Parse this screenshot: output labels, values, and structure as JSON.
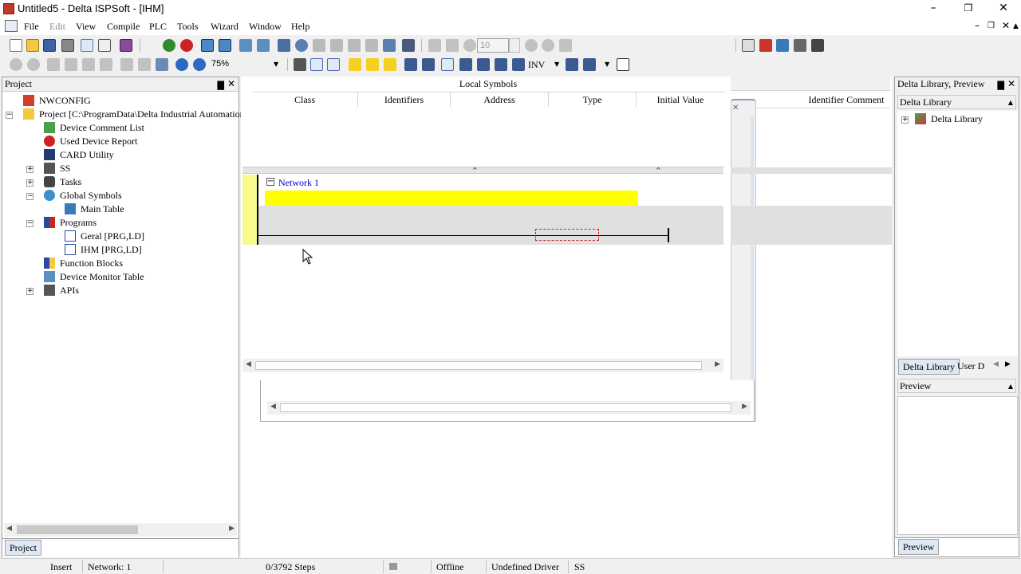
{
  "window": {
    "title": "Untitled5 - Delta ISPSoft - [IHM]",
    "minimize": "–",
    "maximize": "❐",
    "close": "✕"
  },
  "menu": {
    "items": [
      "File",
      "Edit",
      "View",
      "Compile",
      "PLC",
      "Tools",
      "Wizard",
      "Window",
      "Help"
    ],
    "mdi_minimize": "–",
    "mdi_restore": "❐",
    "mdi_close": "✕"
  },
  "toolbar": {
    "zoom": "75%",
    "count": "10",
    "inv_label": "INV"
  },
  "project_panel": {
    "title": "Project",
    "pin": "▇",
    "close": "✕",
    "tree": [
      "NWCONFIG",
      "Project [C:\\ProgramData\\Delta Industrial Automation\\I",
      "Device Comment List",
      "Used Device Report",
      "CARD Utility",
      "SS",
      "Tasks",
      "Global Symbols",
      "Main Table",
      "Programs",
      "Geral [PRG,LD]",
      "IHM [PRG,LD]",
      "Function Blocks",
      "Device Monitor Table",
      "APIs"
    ],
    "tab": "Project"
  },
  "editor": {
    "local_symbols_title": "Local Symbols",
    "columns": [
      "Class",
      "Identifiers",
      "Address",
      "Type",
      "Initial Value"
    ],
    "identifier_comment": "Identifier Comment",
    "network_label": "Network 1"
  },
  "library_panel": {
    "title": "Delta Library, Preview",
    "section": "Delta Library",
    "tree_item": "Delta Library",
    "tab_active": "Delta Library",
    "tab_other": "User D",
    "preview_title": "Preview",
    "preview_tab": "Preview"
  },
  "status": {
    "mode": "Insert",
    "network": "Network: 1",
    "steps": "0/3792 Steps",
    "connection": "Offline",
    "driver": "Undefined Driver",
    "task": "SS"
  },
  "colors": {
    "network_yellow": "#ffff00",
    "rung_yellow": "#fafa8c",
    "rung_gray": "#e0e0e0",
    "network_blue": "#0000cc"
  }
}
